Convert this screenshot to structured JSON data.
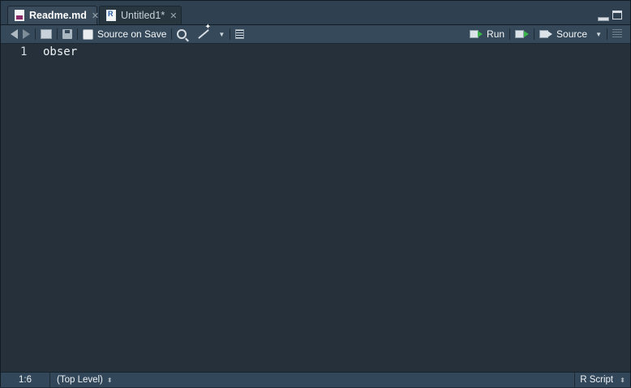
{
  "tabs": [
    {
      "label": "Readme.md",
      "active": true,
      "icon": "markdown-doc-icon"
    },
    {
      "label": "Untitled1*",
      "active": false,
      "icon": "r-script-doc-icon"
    }
  ],
  "toolbar": {
    "source_on_save_label": "Source on Save",
    "source_on_save_checked": false,
    "run_label": "Run",
    "source_label": "Source"
  },
  "editor": {
    "line_numbers": [
      "1"
    ],
    "lines": [
      "obser"
    ]
  },
  "status": {
    "position": "1:6",
    "scope": "(Top Level)",
    "file_type": "R Script"
  },
  "colors": {
    "editor_bg": "#25303a",
    "toolbar_bg": "#35495a",
    "run_arrow": "#39b54a"
  }
}
